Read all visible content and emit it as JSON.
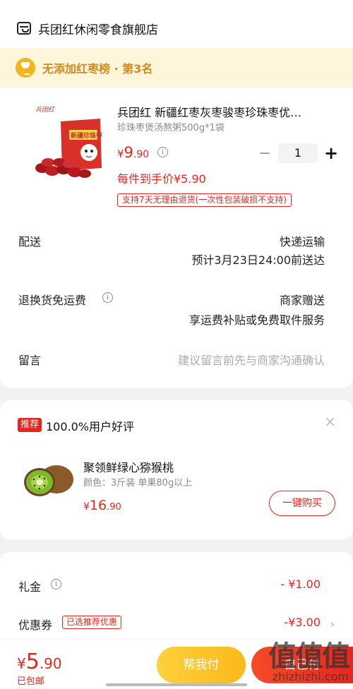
{
  "store": {
    "name": "兵团红休闲零食旗舰店",
    "icon": "store-icon"
  },
  "ranking": {
    "text": "无添加红枣榜 · 第3名",
    "icon": "trophy-icon"
  },
  "product": {
    "image_text": "新疆珍珠枣",
    "brand_mark": "兵团红",
    "title": "兵团红 新疆红枣灰枣骏枣珍珠枣优…",
    "sku": "珍珠枣煲汤熬粥500g*1袋",
    "price_symbol": "¥",
    "price_int": "9",
    "price_dec": ".90",
    "quantity": "1",
    "minus": "−",
    "plus": "+",
    "unit_price": "每件到手价¥5.90",
    "return_policy": "支持7天无理由退货(一次性包装破损不支持)"
  },
  "delivery": {
    "label": "配送",
    "method": "快递运输",
    "eta": "预计3月23日24:00前送达"
  },
  "returns": {
    "label": "退换货免运费",
    "value": "商家赠送",
    "detail": "享运费补贴或免费取件服务"
  },
  "message": {
    "label": "留言",
    "placeholder": "建议留言前先与商家沟通确认"
  },
  "recommendation": {
    "badge": "推荐",
    "title": "100.0%用户好评",
    "close": "×",
    "name": "聚领鲜绿心猕猴桃",
    "spec": "颜色：3斤装 单果80g以上",
    "price_symbol": "¥",
    "price_int": "16",
    "price_dec": ".90",
    "buy_label": "一键购买"
  },
  "discounts": {
    "gift_label": "礼金",
    "gift_amount": "- ¥1.00",
    "coupon_label": "优惠券",
    "coupon_tag": "已选推荐优惠",
    "coupon_amount": "-¥3.00",
    "chevron": "›"
  },
  "footer": {
    "total_symbol": "¥",
    "total_int": "5",
    "total_dec": ".90",
    "shipping": "已包邮",
    "help_pay": "帮我付",
    "pay": "自己付"
  },
  "watermark": {
    "logo": "值值值",
    "url": "zhizhizhi.com"
  },
  "colors": {
    "accent": "#e5261d",
    "banner_bg": "#fdf6da",
    "banner_text": "#d4881a",
    "help_pay": "#f9b91b"
  }
}
